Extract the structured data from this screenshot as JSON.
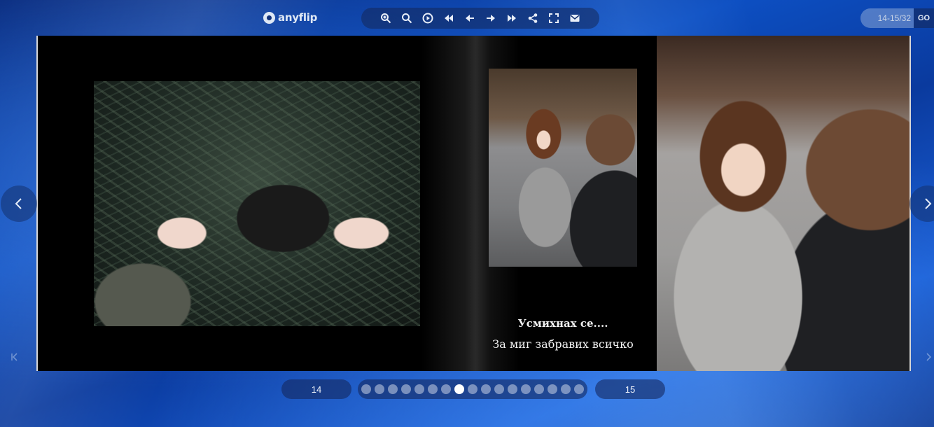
{
  "header": {
    "logo_text": "anyflip",
    "toolbar": [
      {
        "name": "zoom-in-icon"
      },
      {
        "name": "search-icon"
      },
      {
        "name": "autoplay-icon"
      },
      {
        "name": "first-page-icon"
      },
      {
        "name": "previous-page-icon"
      },
      {
        "name": "next-page-icon"
      },
      {
        "name": "last-page-icon"
      },
      {
        "name": "share-icon"
      },
      {
        "name": "fullscreen-icon"
      },
      {
        "name": "email-icon"
      }
    ],
    "page_indicator": "14-15/32",
    "go_label": "GO"
  },
  "book": {
    "caption_line1": "Усмихнах се....",
    "caption_line2": "За миг забравих всичко"
  },
  "footer": {
    "left_page": "14",
    "right_page": "15",
    "dot_count": 17,
    "active_dot_index": 7
  },
  "colors": {
    "accent": "#0d4fc2",
    "page_background": "#000000",
    "caption_text": "#f2f2f2"
  }
}
